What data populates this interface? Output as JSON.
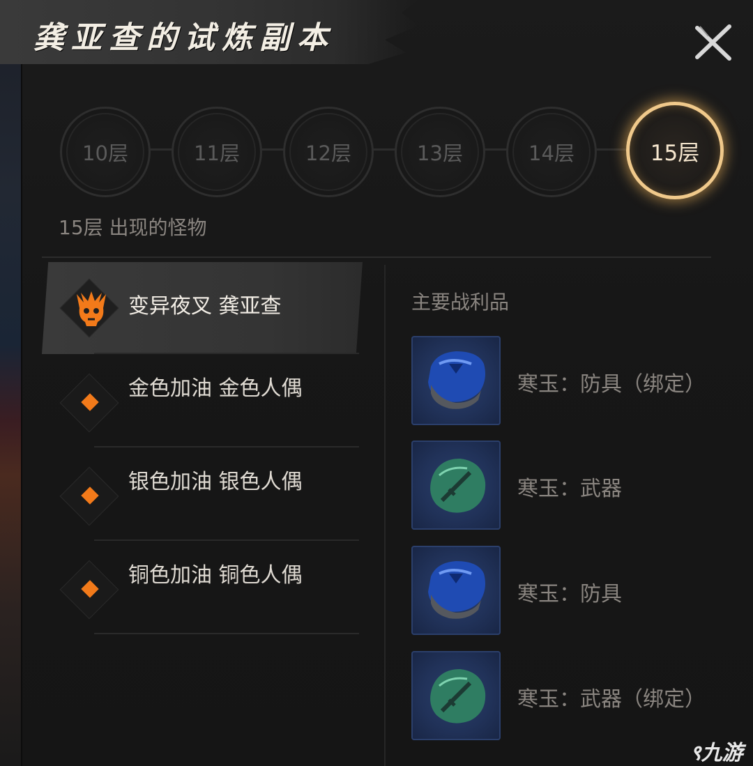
{
  "window": {
    "title": "龚亚查的试炼副本"
  },
  "floors": [
    {
      "label": "10层",
      "active": false
    },
    {
      "label": "11层",
      "active": false
    },
    {
      "label": "12层",
      "active": false
    },
    {
      "label": "13层",
      "active": false
    },
    {
      "label": "14层",
      "active": false
    },
    {
      "label": "15层",
      "active": true
    }
  ],
  "monsters_section": {
    "title": "15层 出现的怪物"
  },
  "monsters": [
    {
      "name": "变异夜叉 龚亚查",
      "icon": "demon-skull-icon",
      "selected": true
    },
    {
      "name": "金色加油 金色人偶",
      "icon": "orange-diamond-icon",
      "selected": false
    },
    {
      "name": "银色加油 银色人偶",
      "icon": "orange-diamond-icon",
      "selected": false
    },
    {
      "name": "铜色加油 铜色人偶",
      "icon": "orange-diamond-icon",
      "selected": false
    }
  ],
  "loot": {
    "title": "主要战利品",
    "items": [
      {
        "name": "寒玉：防具（绑定）",
        "icon": "blue-jade-armor-icon"
      },
      {
        "name": "寒玉：武器",
        "icon": "green-jade-weapon-icon"
      },
      {
        "name": "寒玉：防具",
        "icon": "blue-jade-armor-icon"
      },
      {
        "name": "寒玉：武器（绑定）",
        "icon": "green-jade-weapon-icon"
      }
    ]
  },
  "watermark": {
    "text": "九游"
  },
  "colors": {
    "accent_gold": "#f0c98b",
    "monster_orange": "#f27a1a",
    "panel_bg": "#171717"
  }
}
